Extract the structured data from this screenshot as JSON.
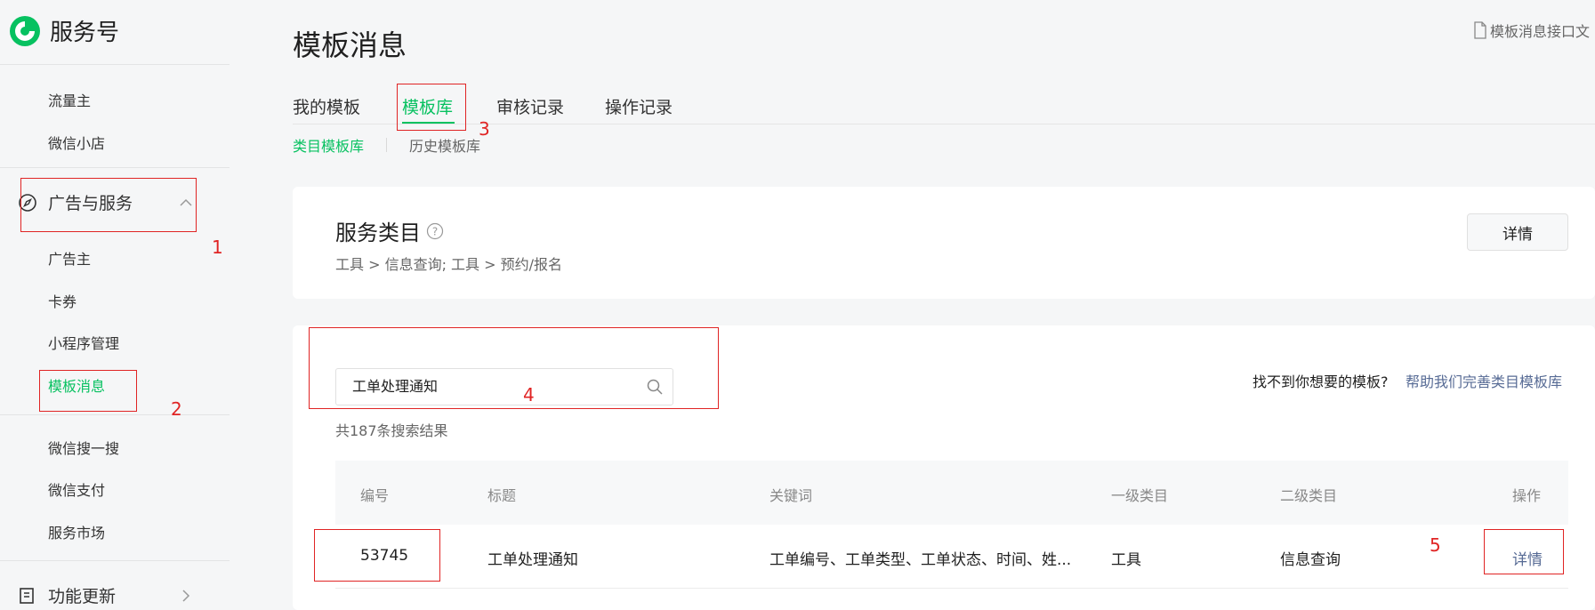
{
  "brand": {
    "name": "服务号",
    "color": "#07c160"
  },
  "sidebar": {
    "items_top": [
      {
        "label": "流量主"
      },
      {
        "label": "微信小店"
      }
    ],
    "group_ads": {
      "label": "广告与服务",
      "icon": "compass-icon",
      "state": "expanded"
    },
    "items_ads": [
      {
        "label": "广告主"
      },
      {
        "label": "卡券"
      },
      {
        "label": "小程序管理"
      },
      {
        "label": "模板消息",
        "active": true
      }
    ],
    "items_bottom": [
      {
        "label": "微信搜一搜"
      },
      {
        "label": "微信支付"
      },
      {
        "label": "服务市场"
      }
    ],
    "group_updates": {
      "label": "功能更新",
      "icon": "update-icon",
      "state": "collapsed"
    }
  },
  "header": {
    "title": "模板消息",
    "doc_link": "模板消息接口文"
  },
  "tabs": [
    {
      "label": "我的模板"
    },
    {
      "label": "模板库",
      "active": true
    },
    {
      "label": "审核记录"
    },
    {
      "label": "操作记录"
    }
  ],
  "subtabs": [
    {
      "label": "类目模板库",
      "active": true
    },
    {
      "label": "历史模板库"
    }
  ],
  "category_card": {
    "title": "服务类目",
    "path": "工具 > 信息查询; 工具 > 预约/报名",
    "detail_button": "详情"
  },
  "search": {
    "value": "工单处理通知",
    "result_count": "共187条搜索结果",
    "help_question": "找不到你想要的模板?",
    "help_link": "帮助我们完善类目模板库"
  },
  "table": {
    "headers": [
      "编号",
      "标题",
      "关键词",
      "一级类目",
      "二级类目",
      "操作"
    ],
    "rows": [
      {
        "id": "53745",
        "title": "工单处理通知",
        "keywords": "工单编号、工单类型、工单状态、时间、姓...",
        "level1": "工具",
        "level2": "信息查询",
        "action": "详情"
      }
    ]
  },
  "annotations": [
    "1",
    "2",
    "3",
    "4",
    "5"
  ],
  "colors": {
    "accent": "#07c160",
    "link": "#576b95",
    "annotation": "#e02424"
  }
}
